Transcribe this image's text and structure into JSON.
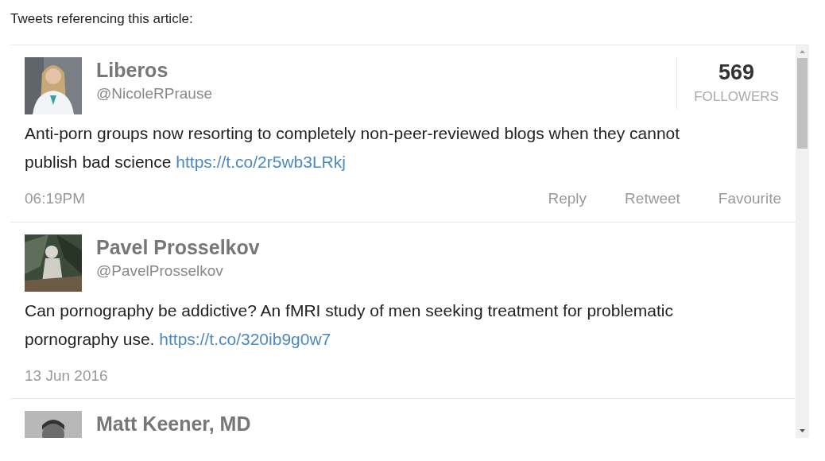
{
  "heading": "Tweets referencing this article:",
  "tweets": [
    {
      "name": "Liberos",
      "handle": "@NicoleRPrause",
      "text": "Anti-porn groups now resorting to completely non-peer-reviewed blogs when they cannot publish bad science",
      "link": "https://t.co/2r5wb3LRkj",
      "time": "06:19PM",
      "followers": {
        "count": "569",
        "label": "FOLLOWERS"
      },
      "actions": [
        "Reply",
        "Retweet",
        "Favourite"
      ]
    },
    {
      "name": "Pavel Prosselkov",
      "handle": "@PavelProsselkov",
      "text": "Can pornography be addictive? An fMRI study of men seeking treatment for problematic pornography use.",
      "link": "https://t.co/320ib9g0w7",
      "time": "13 Jun 2016"
    },
    {
      "name": "Matt Keener, MD"
    }
  ]
}
